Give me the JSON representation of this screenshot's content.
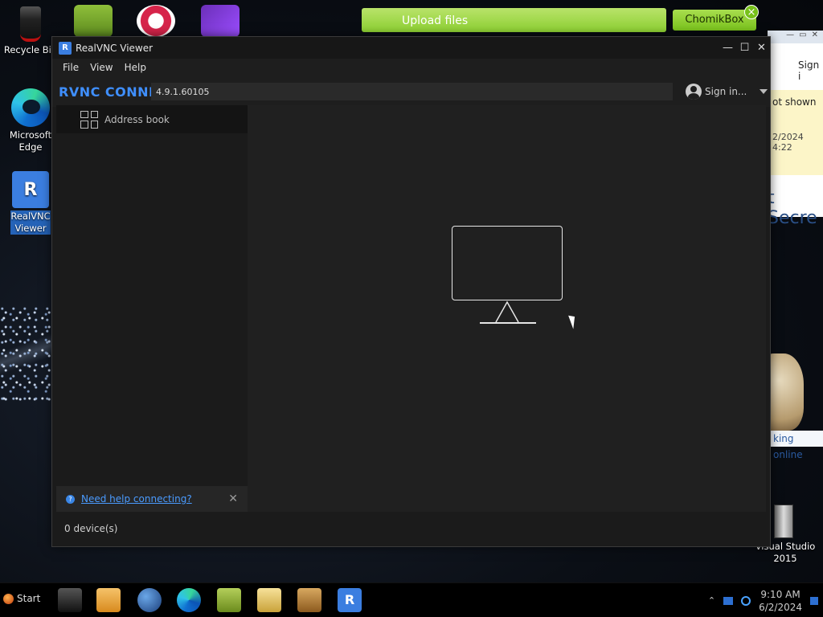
{
  "desktop": {
    "icons": [
      {
        "label": "Recycle Bin"
      },
      {
        "label": "Microsoft Edge"
      },
      {
        "label": "RealVNC Viewer"
      },
      {
        "label": "Visual Studio 2015"
      }
    ],
    "upload_banner": "Upload files",
    "chomikbox_button": "ChomikBox",
    "chomik_online": "king online"
  },
  "background_window": {
    "sign": "Sign i",
    "not_shown": "ot shown",
    "date": "2/2024 4:22",
    "secret": "t Secre"
  },
  "vnc": {
    "title": "RealVNC Viewer",
    "menu": [
      "File",
      "View",
      "Help"
    ],
    "logo": "RVNC CONNECT",
    "address_value": "4.9.1.60105",
    "sign_in": "Sign in...",
    "address_book": "Address book",
    "help_link": "Need help connecting?",
    "status": "0 device(s)"
  },
  "taskbar": {
    "start": "Start",
    "time": "9:10 AM",
    "date": "6/2/2024"
  },
  "colors": {
    "accent": "#3f8fff",
    "window_bg": "#1b1b1b",
    "upload_green": "#8ccf32"
  }
}
